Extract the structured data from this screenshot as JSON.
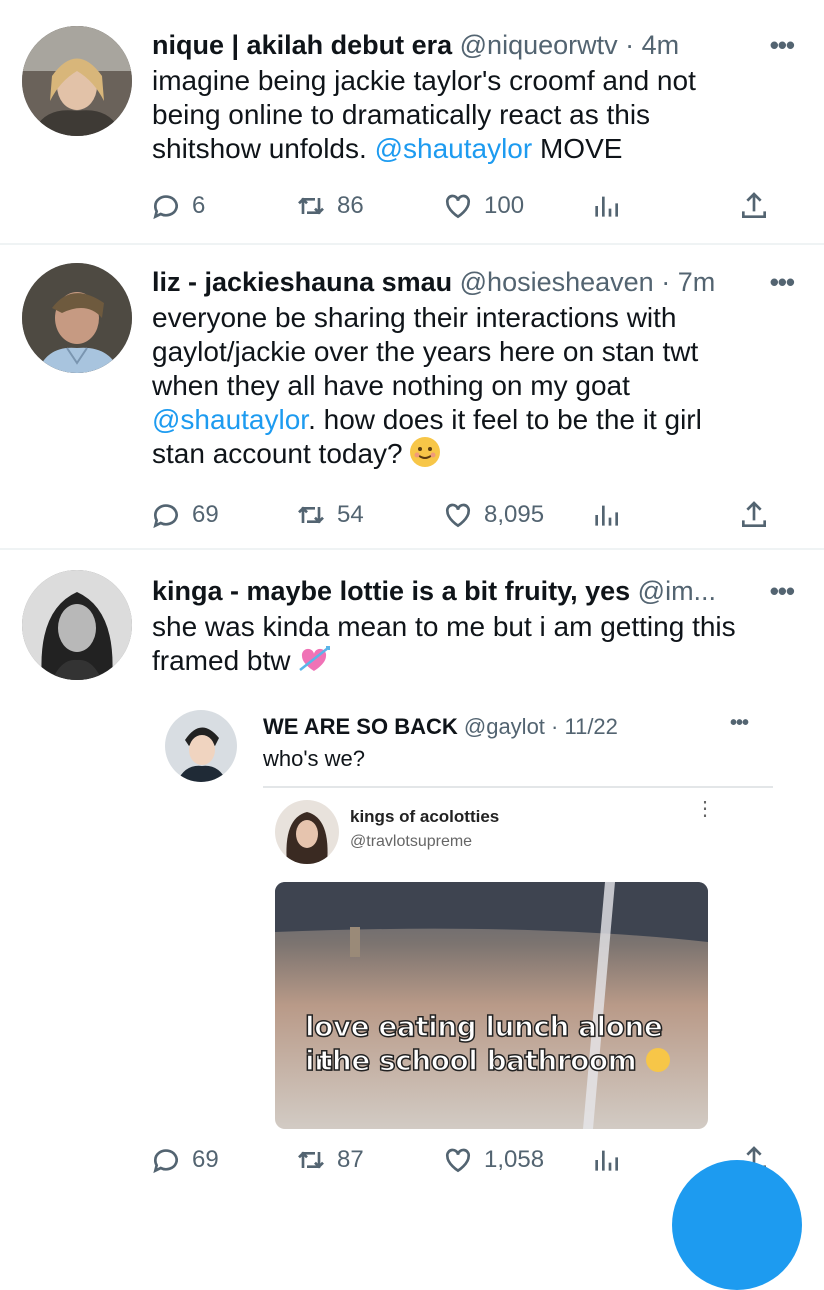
{
  "tweets": [
    {
      "name": "nique | akilah debut era",
      "handle": "@niqueorwtv",
      "time": "· 4m",
      "more": "•••",
      "text_lines": [
        "imagine being jackie taylor's croomf and not",
        "being online to dramatically react as this",
        "shitshow unfolds."
      ],
      "mention": "@shautaylor",
      "tail": " MOVE",
      "replies": "6",
      "retweets": "86",
      "likes": "100"
    },
    {
      "name": "liz - jackieshauna smau",
      "handle": "@hosiesheaven",
      "time": "· 7m",
      "more": "•••",
      "text_lines": [
        "everyone be sharing their interactions with",
        "gaylot/jackie over the years here on stan twt",
        "when they all have nothing on my goat"
      ],
      "mention": "@shautaylor",
      "tail": ". how does it feel to be the it girl",
      "last_line": "stan account today?",
      "emoji": "smiling-face-emoji",
      "replies": "69",
      "retweets": "54",
      "likes": "8,095"
    },
    {
      "name": "kinga - maybe lottie is a bit fruity, yes",
      "handle": "@im...",
      "more": "•••",
      "text_lines": [
        "she was kinda mean to me but i am getting this",
        "framed btw"
      ],
      "emoji": "heart-with-arrow-emoji",
      "replies": "69",
      "retweets": "87",
      "likes": "1,058",
      "quote": {
        "name": "WE ARE SO BACK",
        "handle": "@gaylot",
        "time": "· 11/22",
        "more": "•••",
        "text": "who's we?",
        "inner": {
          "name": "kings of acolotties",
          "handle": "@travlotsupreme",
          "dots": "⋮",
          "caption_line1": "love eating lunch alone in",
          "caption_line2": "the school bathroom"
        }
      }
    }
  ],
  "colors": {
    "accent": "#1d9bf0",
    "muted": "#536471",
    "text": "#0f1419"
  }
}
